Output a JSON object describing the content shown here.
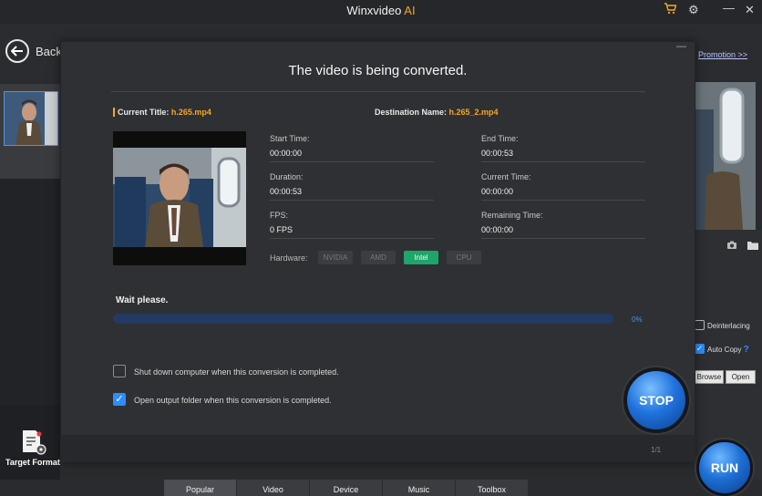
{
  "window": {
    "title_main": "Winxvideo",
    "title_accent": "AI",
    "icons": [
      "cart-icon",
      "gear-icon",
      "minimize-icon",
      "close-icon"
    ]
  },
  "toolbar": {
    "back_label": "Back",
    "promotion_link": "Promotion >>"
  },
  "left_panel": {
    "target_format_label": "Target Format"
  },
  "right_panel": {
    "deinterlacing_label": "Deinterlacing",
    "deinterlacing_checked": false,
    "auto_copy_label": "Auto Copy",
    "auto_copy_checked": true,
    "help_glyph": "?",
    "browse_label": "Browse",
    "open_label": "Open"
  },
  "bottom_tabs": [
    {
      "label": "Popular",
      "active": true
    },
    {
      "label": "Video",
      "active": false
    },
    {
      "label": "Device",
      "active": false
    },
    {
      "label": "Music",
      "active": false
    },
    {
      "label": "Toolbox",
      "active": false
    }
  ],
  "run_label": "RUN",
  "dialog": {
    "title": "The video is being converted.",
    "minimize_glyph": "—",
    "current_title_label": "Current Title:",
    "current_title_value": "h.265.mp4",
    "destination_label": "Destination Name:",
    "destination_value": "h.265_2.mp4",
    "fields": {
      "start_time": {
        "label": "Start Time:",
        "value": "00:00:00"
      },
      "end_time": {
        "label": "End Time:",
        "value": "00:00:53"
      },
      "duration": {
        "label": "Duration:",
        "value": "00:00:53"
      },
      "current_time": {
        "label": "Current Time:",
        "value": "00:00:00"
      },
      "fps": {
        "label": "FPS:",
        "value": "0 FPS"
      },
      "remaining_time": {
        "label": "Remaining Time:",
        "value": "00:00:00"
      }
    },
    "hardware_label": "Hardware:",
    "hardware_options": [
      {
        "label": "NVIDIA",
        "active": false
      },
      {
        "label": "AMD",
        "active": false
      },
      {
        "label": "Intel",
        "active": true
      },
      {
        "label": "CPU",
        "active": false
      }
    ],
    "wait_text": "Wait please.",
    "progress_percent": 0,
    "progress_label": "0%",
    "shutdown_label": "Shut down computer when this conversion is completed.",
    "shutdown_checked": false,
    "open_folder_label": "Open output folder when this conversion is completed.",
    "open_folder_checked": true,
    "stop_label": "STOP",
    "page_indicator": "1/1"
  },
  "colors": {
    "accent_orange": "#f5a623",
    "hardware_active": "#1ea56a",
    "progress_track": "#233a63",
    "button_blue": "#2173de"
  }
}
